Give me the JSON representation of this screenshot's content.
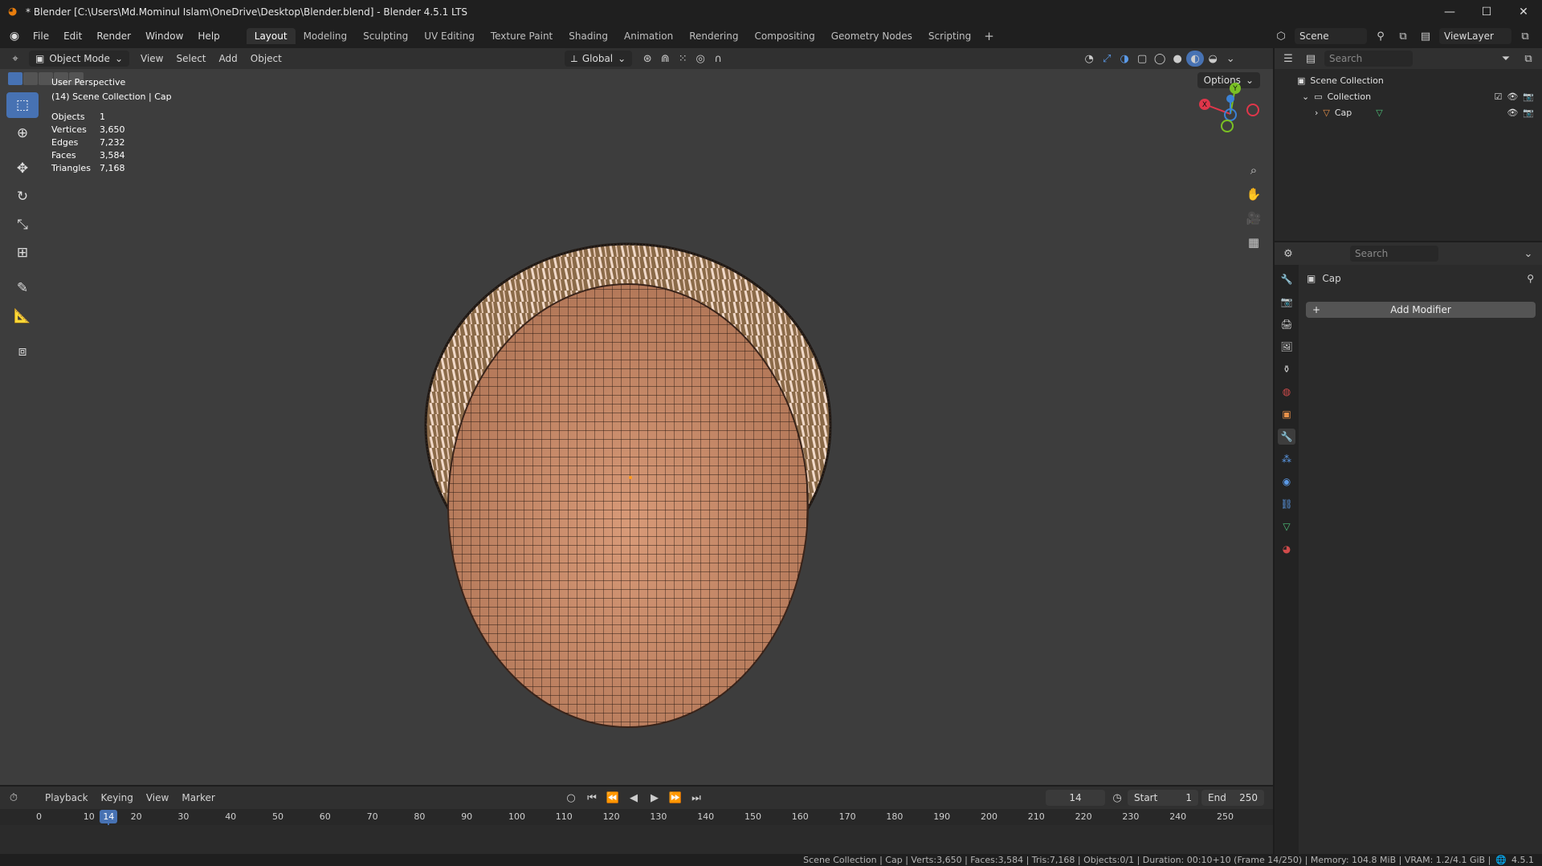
{
  "window": {
    "title": "* Blender [C:\\Users\\Md.Mominul Islam\\OneDrive\\Desktop\\Blender.blend] - Blender 4.5.1 LTS",
    "minimize": "—",
    "maximize": "☐",
    "close": "✕"
  },
  "menu": [
    "File",
    "Edit",
    "Render",
    "Window",
    "Help"
  ],
  "workspaces": [
    "Layout",
    "Modeling",
    "Sculpting",
    "UV Editing",
    "Texture Paint",
    "Shading",
    "Animation",
    "Rendering",
    "Compositing",
    "Geometry Nodes",
    "Scripting"
  ],
  "active_workspace": "Layout",
  "scene": {
    "name": "Scene",
    "view_layer": "ViewLayer"
  },
  "viewport": {
    "mode": "Object Mode",
    "menus": [
      "View",
      "Select",
      "Add",
      "Object"
    ],
    "transform_orientation": "Global",
    "options_label": "Options",
    "perspective": "User Perspective",
    "context": "(14) Scene Collection | Cap",
    "stats": [
      {
        "label": "Objects",
        "value": "1"
      },
      {
        "label": "Vertices",
        "value": "3,650"
      },
      {
        "label": "Edges",
        "value": "7,232"
      },
      {
        "label": "Faces",
        "value": "3,584"
      },
      {
        "label": "Triangles",
        "value": "7,168"
      }
    ],
    "gizmo_axes": {
      "x": "X",
      "y": "Y",
      "x_color": "#e0364a",
      "y_color": "#7ac024",
      "z_color": "#3b82d6"
    }
  },
  "outliner": {
    "search_placeholder": "Search",
    "root": "Scene Collection",
    "collection": "Collection",
    "object": "Cap"
  },
  "properties": {
    "search_placeholder": "Search",
    "object_name": "Cap",
    "add_modifier": "Add Modifier"
  },
  "timeline": {
    "menus": [
      "Playback",
      "Keying",
      "View",
      "Marker"
    ],
    "current_frame": "14",
    "start_label": "Start",
    "start": "1",
    "end_label": "End",
    "end": "250",
    "ruler": [
      "0",
      "10",
      "20",
      "30",
      "40",
      "50",
      "60",
      "70",
      "80",
      "90",
      "100",
      "110",
      "120",
      "130",
      "140",
      "150",
      "160",
      "170",
      "180",
      "190",
      "200",
      "210",
      "220",
      "230",
      "240",
      "250"
    ],
    "playhead": "14"
  },
  "statusbar": {
    "text": "Scene Collection | Cap | Verts:3,650 | Faces:3,584 | Tris:7,168 | Objects:0/1 | Duration: 00:10+10 (Frame 14/250) | Memory: 104.8 MiB | VRAM: 1.2/4.1 GiB | ",
    "version": "4.5.1"
  },
  "colors": {
    "accent": "#4772b3",
    "viewport_bg": "#3d3d3d",
    "mesh": "#c98c6c"
  }
}
